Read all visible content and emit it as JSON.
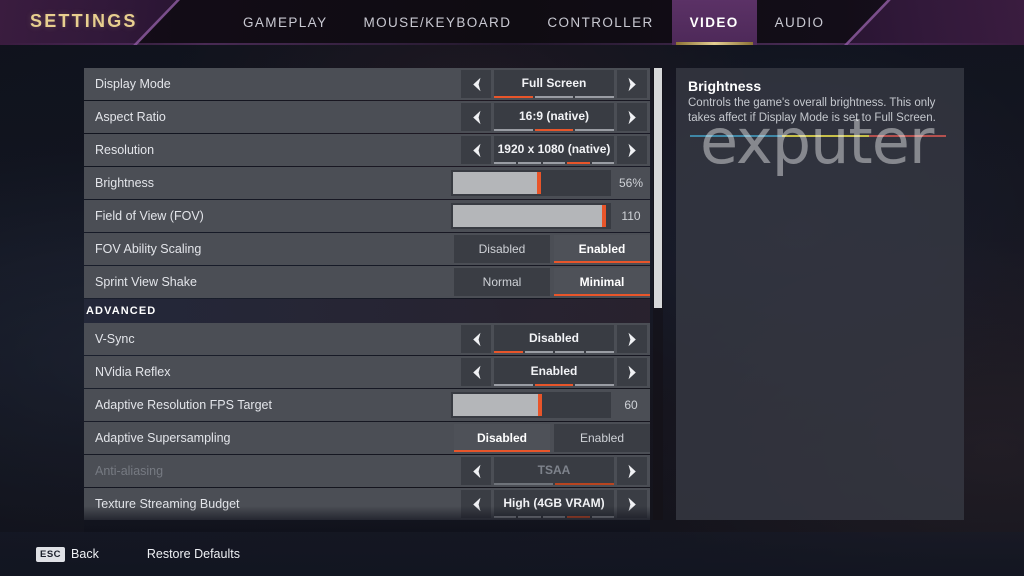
{
  "header": {
    "title": "SETTINGS",
    "tabs": [
      {
        "label": "GAMEPLAY",
        "active": false
      },
      {
        "label": "MOUSE/KEYBOARD",
        "active": false
      },
      {
        "label": "CONTROLLER",
        "active": false
      },
      {
        "label": "VIDEO",
        "active": true
      },
      {
        "label": "AUDIO",
        "active": false
      }
    ]
  },
  "colors": {
    "accent_orange": "#e8552a",
    "accent_gold": "#e5cf93",
    "tab_active_bg": "#68387 4",
    "row_bg": "#4b4e55",
    "panel_bg": "#373a44"
  },
  "settings": {
    "rows": [
      {
        "label": "Display Mode",
        "type": "stepper",
        "value": "Full Screen",
        "segments": 3,
        "active_segment": 1,
        "disabled": false
      },
      {
        "label": "Aspect Ratio",
        "type": "stepper",
        "value": "16:9 (native)",
        "segments": 3,
        "active_segment": 2,
        "disabled": false
      },
      {
        "label": "Resolution",
        "type": "stepper",
        "value": "1920 x 1080 (native)",
        "segments": 5,
        "active_segment": 4,
        "disabled": false
      },
      {
        "label": "Brightness",
        "type": "slider",
        "value": "56%",
        "fill_percent": 56,
        "disabled": false
      },
      {
        "label": "Field of View (FOV)",
        "type": "slider",
        "value": "110",
        "fill_percent": 97,
        "disabled": false
      },
      {
        "label": "FOV Ability Scaling",
        "type": "toggle",
        "options": [
          "Disabled",
          "Enabled"
        ],
        "selected_index": 1,
        "disabled": false
      },
      {
        "label": "Sprint View Shake",
        "type": "toggle",
        "options": [
          "Normal",
          "Minimal"
        ],
        "selected_index": 1,
        "disabled": false
      },
      {
        "label": "ADVANCED",
        "type": "section"
      },
      {
        "label": "V-Sync",
        "type": "stepper",
        "value": "Disabled",
        "segments": 4,
        "active_segment": 1,
        "disabled": false
      },
      {
        "label": "NVidia Reflex",
        "type": "stepper",
        "value": "Enabled",
        "segments": 3,
        "active_segment": 2,
        "disabled": false
      },
      {
        "label": "Adaptive Resolution FPS Target",
        "type": "slider",
        "value": "60",
        "fill_percent": 57,
        "disabled": false
      },
      {
        "label": "Adaptive Supersampling",
        "type": "toggle",
        "options": [
          "Disabled",
          "Enabled"
        ],
        "selected_index": 0,
        "disabled": false
      },
      {
        "label": "Anti-aliasing",
        "type": "stepper",
        "value": "TSAA",
        "segments": 2,
        "active_segment": 2,
        "disabled": true
      },
      {
        "label": "Texture Streaming Budget",
        "type": "stepper",
        "value": "High (4GB VRAM)",
        "segments": 5,
        "active_segment": 4,
        "disabled": false
      }
    ]
  },
  "description": {
    "title": "Brightness",
    "body": "Controls the game's overall brightness. This only takes affect if Display Mode is set to Full Screen."
  },
  "watermark": {
    "text": "exputer"
  },
  "footer": {
    "back_key": "ESC",
    "back_label": "Back",
    "restore_label": "Restore Defaults"
  }
}
